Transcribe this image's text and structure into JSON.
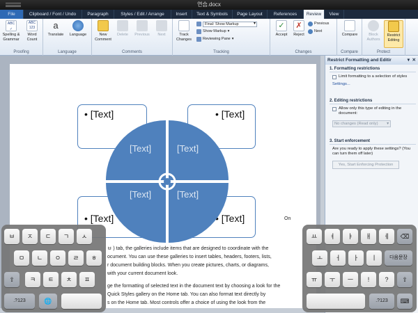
{
  "window": {
    "title": "연습.docx"
  },
  "tabs": [
    {
      "label": "File",
      "active": false
    },
    {
      "label": "Clipboard / Font / Undo",
      "active": false
    },
    {
      "label": "Paragraph",
      "active": false
    },
    {
      "label": "Styles / Edit / Arrange",
      "active": false
    },
    {
      "label": "Insert",
      "active": false
    },
    {
      "label": "Text & Symbols",
      "active": false
    },
    {
      "label": "Page Layout",
      "active": false
    },
    {
      "label": "References",
      "active": false
    },
    {
      "label": "Review",
      "active": true
    },
    {
      "label": "View",
      "active": false
    }
  ],
  "ribbon": {
    "proofing": {
      "label": "Proofing",
      "spelling": "Spelling & Grammar",
      "abc_top": "ABC",
      "abc_mid": "123",
      "wordcount": "Word Count"
    },
    "language": {
      "label": "Language",
      "translate": "Translate",
      "language": "Language"
    },
    "comments": {
      "label": "Comments",
      "new": "New Comment",
      "delete": "Delete",
      "previous": "Previous",
      "next": "Next"
    },
    "tracking": {
      "label": "Tracking",
      "track": "Track Changes",
      "markup_value": "Final: Show Markup",
      "show_markup": "Show Markup",
      "reviewing_pane": "Reviewing Pane"
    },
    "changes": {
      "label": "Changes",
      "accept": "Accept",
      "reject": "Reject",
      "previous": "Previous",
      "next": "Next"
    },
    "compare": {
      "label": "Compare",
      "compare": "Compare"
    },
    "protect": {
      "label": "Protect",
      "block": "Block Authors",
      "restrict": "Restrict Editing"
    }
  },
  "document": {
    "smartart": {
      "top_left": "• [Text]",
      "top_right": "• [Text]",
      "bottom_left": "• [Text]",
      "bottom_right": "• [Text]",
      "seg1": "[Text]",
      "seg2": "[Text]",
      "seg3": "[Text]",
      "seg4": "[Text]"
    },
    "lines": [
      "On",
      "ㅂ ) tab, the galleries include items that are designed to coordinate with the",
      "ocument. You can use these galleries to insert tables, headers, footers, lists,",
      "r document building blocks. When you create pictures, charts, or diagrams,",
      "with your current document look.",
      "ge the formatting of selected text in the document text by choosing a look for the",
      "Quick Styles gallery on the Home tab. You can also format text directly by",
      "s on the Home tab. Most controls offer a choice of using the look from the"
    ]
  },
  "pane": {
    "title": "Restrict Formatting and Editir",
    "s1_title": "1. Formatting restrictions",
    "s1_check": "Limit formatting to a selection of styles",
    "s1_link": "Settings...",
    "s2_title": "2. Editing restrictions",
    "s2_check": "Allow only this type of editing in the document:",
    "s2_combo": "No changes (Read only)",
    "s3_title": "3. Start enforcement",
    "s3_text": "Are you ready to apply these settings? (You can turn them off later)",
    "s3_button": "Yes, Start Enforcing Protection"
  },
  "keyboard_left": {
    "row1": [
      "ㅂ",
      "ㅈ",
      "ㄷ",
      "ㄱ",
      "ㅅ"
    ],
    "row2": [
      "ㅁ",
      "ㄴ",
      "ㅇ",
      "ㄹ",
      "ㅎ"
    ],
    "row3": [
      "⇧",
      "ㅋ",
      "ㅌ",
      "ㅊ",
      "ㅍ"
    ],
    "row4": [
      ".?123",
      "🌐",
      ""
    ]
  },
  "keyboard_right": {
    "row1": [
      "ㅛ",
      "ㅕ",
      "ㅑ",
      "ㅐ",
      "ㅔ",
      "⌫"
    ],
    "row2": [
      "ㅗ",
      "ㅓ",
      "ㅏ",
      "ㅣ",
      "다음문장"
    ],
    "row3": [
      "ㅠ",
      "ㅜ",
      "ㅡ",
      "!",
      "?",
      "⇧"
    ],
    "row4": [
      "",
      ".?123",
      "⌨"
    ]
  }
}
